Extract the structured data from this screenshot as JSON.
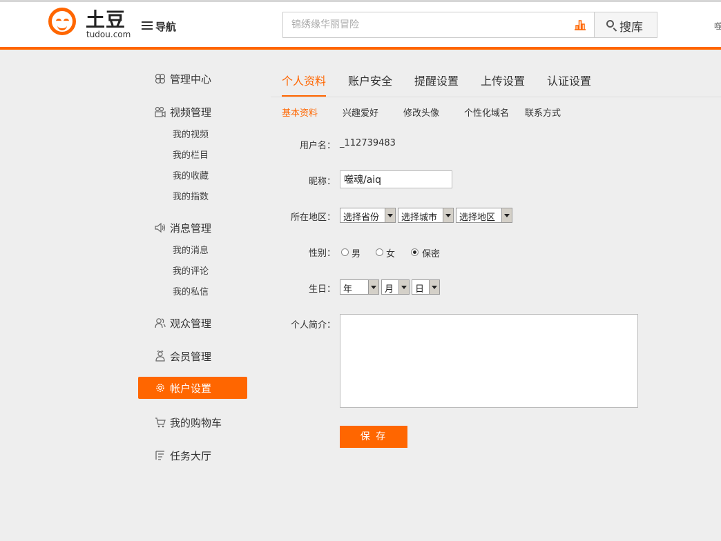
{
  "header": {
    "logo_cn": "土豆",
    "logo_en": "tudou.com",
    "nav_label": "导航",
    "search_placeholder": "锦绣缘华丽冒险",
    "search_button": "搜库",
    "edge_text": "噬"
  },
  "sidebar": {
    "groups": [
      {
        "label": "管理中心",
        "icon": "flower-icon"
      },
      {
        "label": "视频管理",
        "icon": "video-icon",
        "items": [
          "我的视频",
          "我的栏目",
          "我的收藏",
          "我的指数"
        ]
      },
      {
        "label": "消息管理",
        "icon": "speaker-icon",
        "items": [
          "我的消息",
          "我的评论",
          "我的私信"
        ]
      },
      {
        "label": "观众管理",
        "icon": "users-icon"
      },
      {
        "label": "会员管理",
        "icon": "member-icon"
      },
      {
        "label": "帐户设置",
        "icon": "gear-icon",
        "active": true
      },
      {
        "label": "我的购物车",
        "icon": "cart-icon"
      },
      {
        "label": "任务大厅",
        "icon": "task-icon"
      }
    ]
  },
  "tabs": [
    "个人资料",
    "账户安全",
    "提醒设置",
    "上传设置",
    "认证设置"
  ],
  "subtabs": [
    "基本资料",
    "兴趣爱好",
    "修改头像",
    "个性化域名",
    "联系方式"
  ],
  "form": {
    "username_label": "用户名：",
    "username_value": "_112739483",
    "nickname_label": "昵称：",
    "nickname_value": "噬魂/aiq",
    "region_label": "所在地区：",
    "province": "选择省份",
    "city": "选择城市",
    "district": "选择地区",
    "gender_label": "性别：",
    "gender_options": [
      "男",
      "女",
      "保密"
    ],
    "gender_selected": "保密",
    "birthday_label": "生日：",
    "year": "年",
    "month": "月",
    "day": "日",
    "bio_label": "个人简介：",
    "save_label": "保 存"
  },
  "colors": {
    "accent": "#ff6600",
    "background": "#eeeeee"
  }
}
